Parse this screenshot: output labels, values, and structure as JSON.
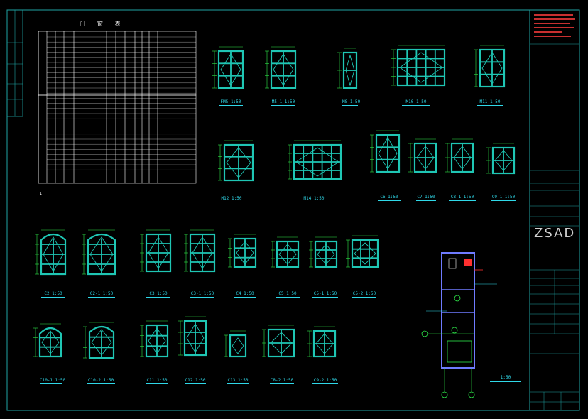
{
  "table": {
    "title": "门 窗 表"
  },
  "notes": {
    "line1": "1.",
    "line2": ""
  },
  "labels": {
    "FM5": "FM5 1:50",
    "M5_1": "M5-1 1:50",
    "M8": "M8 1:50",
    "M10": "M10 1:50",
    "M11": "M11 1:50",
    "M12": "M12 1:50",
    "M14": "M14 1:50",
    "C6": "C6 1:50",
    "C7": "C7 1:50",
    "C8_1": "C8-1 1:50",
    "C9_1": "C9-1 1:50",
    "C2": "C2 1:50",
    "C2_1": "C2-1 1:50",
    "C3": "C3 1:50",
    "C3_1": "C3-1 1:50",
    "C4": "C4 1:50",
    "C5": "C5 1:50",
    "C5_1": "C5-1 1:50",
    "C5_2": "C5-2 1:50",
    "C10_1": "C10-1 1:50",
    "C10_2": "C10-2 1:50",
    "C11": "C11 1:50",
    "C12": "C12 1:50",
    "C13": "C13 1:50",
    "C8_2": "C8-2 1:50",
    "C9_2": "C9-2 1:50",
    "plan": "1:50"
  },
  "title_block": {
    "logo": "ZSAD"
  },
  "colors": {
    "frame": "#1fa3a3",
    "window": "#1fc6b4",
    "dim": "#2ee84a",
    "text": "#2fd8e8",
    "plan": "#6f7bff",
    "accent": "#ff3030"
  }
}
